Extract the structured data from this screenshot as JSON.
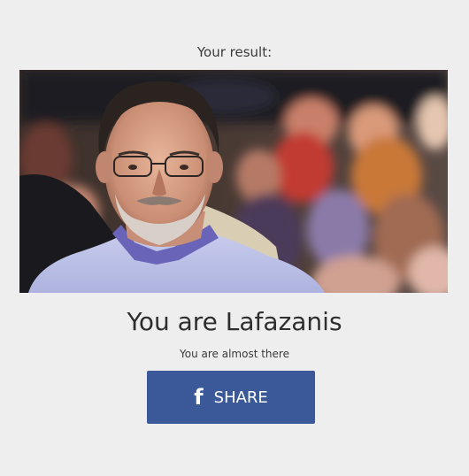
{
  "result": {
    "label": "Your result:",
    "title": "You are Lafazanis",
    "subtitle": "You are almost there",
    "image_icon": "person-photo"
  },
  "share": {
    "label": "SHARE",
    "icon": "facebook-icon",
    "color": "#3b5998"
  },
  "colors": {
    "background": "#eeeeee",
    "text": "#333333"
  }
}
